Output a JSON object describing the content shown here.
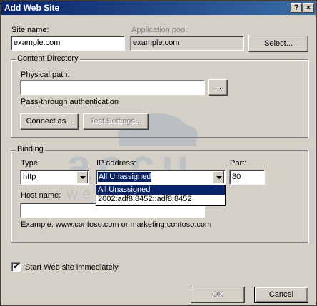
{
  "window": {
    "title": "Add Web Site",
    "help_button": "?",
    "close_button": "×"
  },
  "site": {
    "name_label": "Site name:",
    "name_value": "example.com",
    "pool_label": "Application pool:",
    "pool_value": "example.com",
    "select_button": "Select..."
  },
  "content": {
    "group_title": "Content Directory",
    "physical_path_label": "Physical path:",
    "physical_path_value": "",
    "browse_button": "...",
    "passthrough_label": "Pass-through authentication",
    "connect_button": "Connect as...",
    "test_button": "Test Settings..."
  },
  "binding": {
    "group_title": "Binding",
    "type_label": "Type:",
    "type_value": "http",
    "ip_label": "IP address:",
    "ip_value": "All Unassigned",
    "ip_options": [
      "All Unassigned",
      "2002:adf8:8452::adf8:8452"
    ],
    "port_label": "Port:",
    "port_value": "80",
    "host_label": "Host name:",
    "host_value": "",
    "example_text": "Example: www.contoso.com or marketing.contoso.com"
  },
  "start": {
    "label": "Start Web site immediately",
    "checked": true,
    "check_glyph": "✔"
  },
  "footer": {
    "ok_button": "OK",
    "cancel_button": "Cancel"
  },
  "watermark": {
    "text_top": "accu",
    "text_bottom": "web hosting"
  }
}
